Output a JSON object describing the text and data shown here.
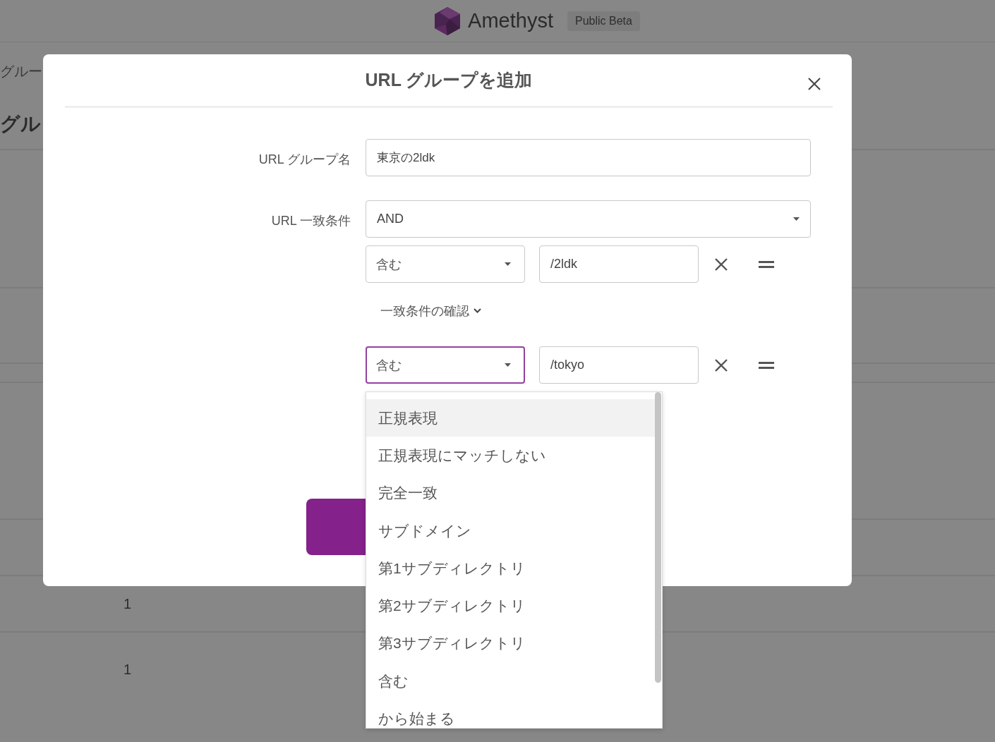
{
  "header": {
    "brand": "Amethyst",
    "badge": "Public Beta"
  },
  "background_page": {
    "breadcrumb": "グルー",
    "heading": "グル",
    "rows": [
      {
        "column_2": "1"
      },
      {
        "column_2": "1"
      }
    ]
  },
  "dialog": {
    "title": "URL グループを追加",
    "name_field": {
      "label": "URL グループ名",
      "value": "東京の2ldk"
    },
    "match_field": {
      "label": "URL 一致条件",
      "operator": "AND",
      "conditions": [
        {
          "operator": "含む",
          "value": "/2ldk",
          "focused": false,
          "preview_toggle": "一致条件の確認"
        },
        {
          "operator": "含む",
          "value": "/tokyo",
          "focused": true
        }
      ]
    }
  },
  "dropdown": {
    "options": [
      {
        "label": "正規表現",
        "selected": true
      },
      {
        "label": "正規表現にマッチしない",
        "selected": false
      },
      {
        "label": "完全一致",
        "selected": false
      },
      {
        "label": "サブドメイン",
        "selected": false
      },
      {
        "label": "第1サブディレクトリ",
        "selected": false
      },
      {
        "label": "第2サブディレクトリ",
        "selected": false
      },
      {
        "label": "第3サブディレクトリ",
        "selected": false
      },
      {
        "label": "含む",
        "selected": false
      },
      {
        "label": "から始まる",
        "selected": false
      }
    ]
  }
}
